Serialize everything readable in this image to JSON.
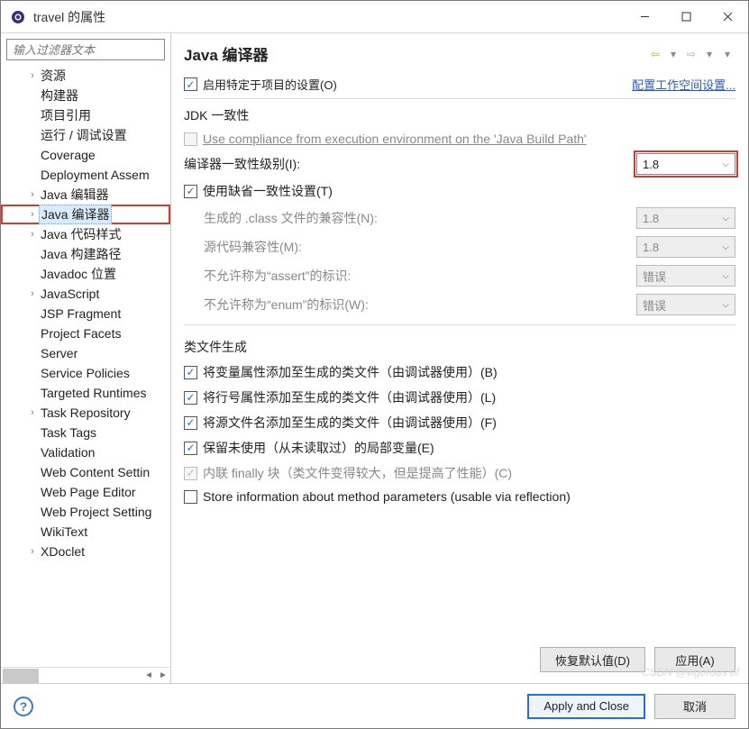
{
  "window": {
    "title": "travel 的属性"
  },
  "sidebar": {
    "filter_placeholder": "输入过滤器文本",
    "items": [
      {
        "label": "资源",
        "expandable": true
      },
      {
        "label": "构建器"
      },
      {
        "label": "项目引用"
      },
      {
        "label": "运行 / 调试设置"
      },
      {
        "label": "Coverage"
      },
      {
        "label": "Deployment Assembly",
        "truncated": "Deployment Assem"
      },
      {
        "label": "Java 编辑器",
        "expandable": true
      },
      {
        "label": "Java 编译器",
        "expandable": true,
        "selected": true,
        "highlighted": true
      },
      {
        "label": "Java 代码样式",
        "expandable": true
      },
      {
        "label": "Java 构建路径"
      },
      {
        "label": "Javadoc 位置"
      },
      {
        "label": "JavaScript",
        "expandable": true
      },
      {
        "label": "JSP Fragment"
      },
      {
        "label": "Project Facets"
      },
      {
        "label": "Server"
      },
      {
        "label": "Service Policies"
      },
      {
        "label": "Targeted Runtimes"
      },
      {
        "label": "Task Repository",
        "expandable": true
      },
      {
        "label": "Task Tags"
      },
      {
        "label": "Validation"
      },
      {
        "label": "Web Content Settings",
        "truncated": "Web Content Settin"
      },
      {
        "label": "Web Page Editor"
      },
      {
        "label": "Web Project Settings",
        "truncated": "Web Project Setting"
      },
      {
        "label": "WikiText"
      },
      {
        "label": "XDoclet",
        "expandable": true
      }
    ]
  },
  "page": {
    "title": "Java 编译器",
    "enable_project_specific": "启用特定于项目的设置(O)",
    "configure_workspace_link": "配置工作空间设置...",
    "jdk_group": "JDK 一致性",
    "use_compliance_pre": "Use compliance from execution environment on the ",
    "use_compliance_link": "'Java Build Path'",
    "compiler_level_label": "编译器一致性级别(I):",
    "compiler_level_value": "1.8",
    "use_default_compliance": "使用缺省一致性设置(T)",
    "class_compat_label": "生成的 .class 文件的兼容性(N):",
    "class_compat_value": "1.8",
    "source_compat_label": "源代码兼容性(M):",
    "source_compat_value": "1.8",
    "assert_label": "不允许称为“assert”的标识:",
    "assert_value": "错误",
    "enum_label": "不允许称为“enum”的标识(W):",
    "enum_value": "错误",
    "classfile_group": "类文件生成",
    "add_var_attrs": "将变量属性添加至生成的类文件（由调试器使用）(B)",
    "add_line_attrs": "将行号属性添加至生成的类文件（由调试器使用）(L)",
    "add_source_file": "将源文件名添加至生成的类文件（由调试器使用）(F)",
    "preserve_unused": "保留未使用（从未读取过）的局部变量(E)",
    "inline_finally": "内联 finally 块（类文件变得较大，但是提高了性能）(C)",
    "store_method_params": "Store information about method parameters (usable via reflection)",
    "restore_defaults": "恢复默认值(D)",
    "apply": "应用(A)"
  },
  "footer": {
    "apply_close": "Apply and Close",
    "cancel": "取消"
  },
  "watermark": "CSDN @vigorous of"
}
